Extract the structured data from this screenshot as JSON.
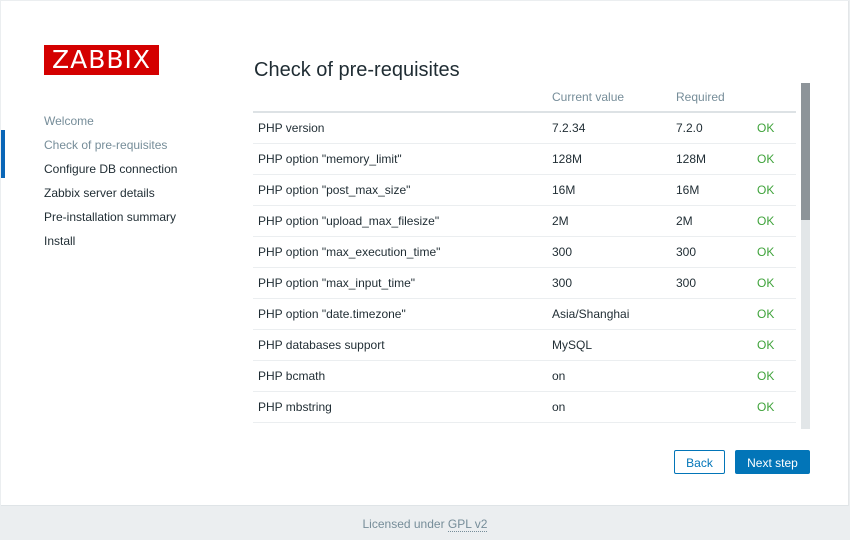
{
  "logo": {
    "text": "ZABBIX"
  },
  "nav": {
    "items": [
      {
        "label": "Welcome",
        "state": "done"
      },
      {
        "label": "Check of pre-requisites",
        "state": "current"
      },
      {
        "label": "Configure DB connection",
        "state": "pending"
      },
      {
        "label": "Zabbix server details",
        "state": "pending"
      },
      {
        "label": "Pre-installation summary",
        "state": "pending"
      },
      {
        "label": "Install",
        "state": "pending"
      }
    ]
  },
  "main": {
    "title": "Check of pre-requisites",
    "columns": [
      "",
      "Current value",
      "Required",
      ""
    ],
    "rows": [
      {
        "name": "PHP version",
        "current": "7.2.34",
        "required": "7.2.0",
        "status": "OK"
      },
      {
        "name": "PHP option \"memory_limit\"",
        "current": "128M",
        "required": "128M",
        "status": "OK"
      },
      {
        "name": "PHP option \"post_max_size\"",
        "current": "16M",
        "required": "16M",
        "status": "OK"
      },
      {
        "name": "PHP option \"upload_max_filesize\"",
        "current": "2M",
        "required": "2M",
        "status": "OK"
      },
      {
        "name": "PHP option \"max_execution_time\"",
        "current": "300",
        "required": "300",
        "status": "OK"
      },
      {
        "name": "PHP option \"max_input_time\"",
        "current": "300",
        "required": "300",
        "status": "OK"
      },
      {
        "name": "PHP option \"date.timezone\"",
        "current": "Asia/Shanghai",
        "required": "",
        "status": "OK"
      },
      {
        "name": "PHP databases support",
        "current": "MySQL",
        "required": "",
        "status": "OK"
      },
      {
        "name": "PHP bcmath",
        "current": "on",
        "required": "",
        "status": "OK"
      },
      {
        "name": "PHP mbstring",
        "current": "on",
        "required": "",
        "status": "OK"
      }
    ]
  },
  "buttons": {
    "back": "Back",
    "next": "Next step"
  },
  "footer": {
    "prefix": "Licensed under",
    "link": "GPL v2"
  },
  "colors": {
    "brand": "#d40000",
    "accent": "#0275b8",
    "ok": "#3fa33b",
    "muted": "#768d99"
  }
}
